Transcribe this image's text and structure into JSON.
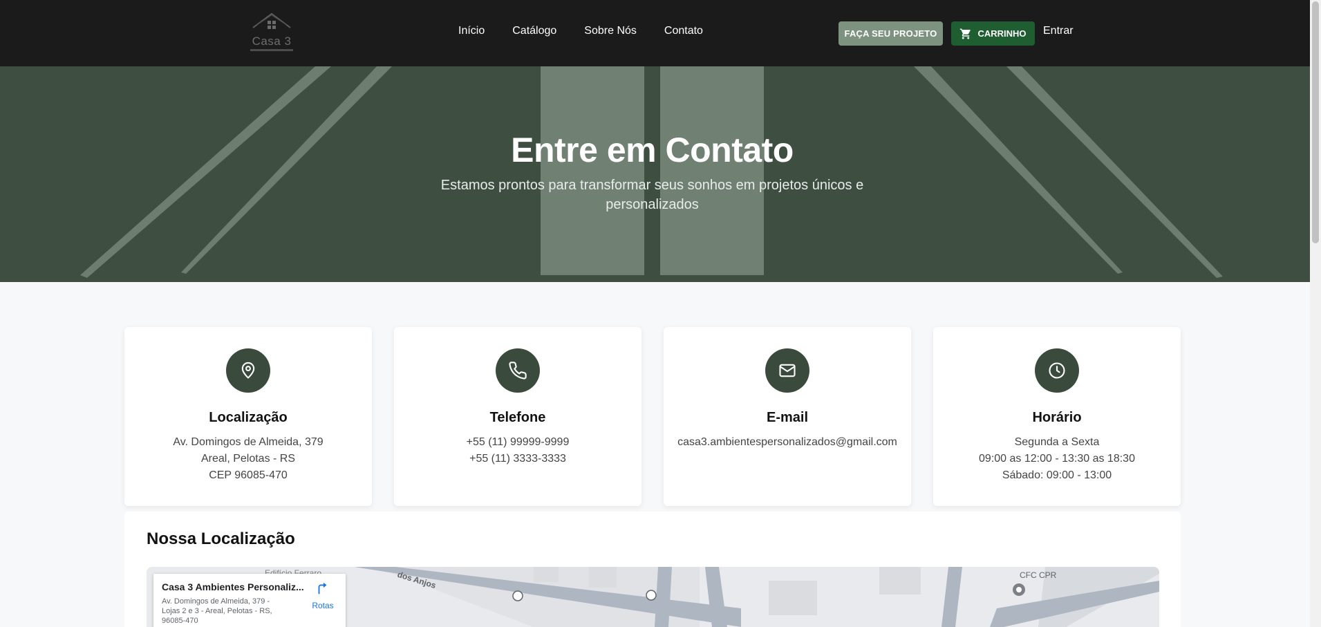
{
  "nav": {
    "logo_text": "Casa 3",
    "links": [
      "Início",
      "Catálogo",
      "Sobre Nós",
      "Contato"
    ],
    "project_button": "FAÇA SEU PROJETO",
    "cart_button": "CARRINHO",
    "login": "Entrar"
  },
  "hero": {
    "title": "Entre em Contato",
    "subtitle": "Estamos prontos para transformar seus sonhos em projetos únicos e personalizados"
  },
  "cards": [
    {
      "icon": "map-pin-icon",
      "title": "Localização",
      "lines": [
        "Av. Domingos de Almeida, 379",
        "Areal, Pelotas - RS",
        "CEP 96085-470"
      ]
    },
    {
      "icon": "phone-icon",
      "title": "Telefone",
      "lines": [
        "+55 (11) 99999-9999",
        "+55 (11) 3333-3333"
      ]
    },
    {
      "icon": "mail-icon",
      "title": "E-mail",
      "lines": [
        "casa3.ambientespersonalizados@gmail.com"
      ]
    },
    {
      "icon": "clock-icon",
      "title": "Horário",
      "lines": [
        "Segunda a Sexta",
        "09:00 as 12:00 - 13:30 as 18:30",
        "Sábado: 09:00 - 13:00"
      ]
    }
  ],
  "location": {
    "title": "Nossa Localização",
    "map": {
      "place_name": "Casa 3 Ambientes Personaliz...",
      "address": "Av. Domingos de Almeida, 379 - Lojas 2 e 3 - Areal, Pelotas - RS, 96085-470",
      "directions_label": "Rotas",
      "poi_label": "CFC CPR",
      "street_label": "dos Anjos",
      "building_label": "Edifício Ferraro"
    }
  },
  "colors": {
    "navbar": "#1b1b1b",
    "hero": "#3e4f42",
    "icon_circle": "#3a4b3d",
    "project_button": "#7e937f",
    "cart_button": "#1e5e31"
  }
}
